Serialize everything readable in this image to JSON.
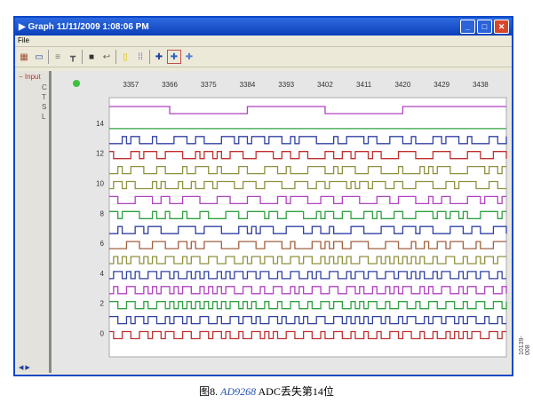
{
  "window": {
    "title": "Graph 11/11/2009 1:08:06 PM",
    "menu": [
      "File"
    ],
    "controls": [
      "_",
      "□",
      "✕"
    ]
  },
  "toolbar": {
    "tools": [
      "open-icon",
      "window-icon",
      "list-icon",
      "tree-icon",
      "save-icon",
      "undo-icon",
      "yellow-marker-icon",
      "blue-marker-icon",
      "crosshair-icon",
      "zoom-crosshair-icon",
      "pan-crosshair-icon"
    ]
  },
  "tree": {
    "root": "Input",
    "children": [
      "C",
      "T",
      "S",
      "L"
    ]
  },
  "chart_data": {
    "type": "line",
    "title": "",
    "xlabel": "",
    "ylabel": "",
    "x_ticks": [
      "3357",
      "3366",
      "3375",
      "3384",
      "3393",
      "3402",
      "3411",
      "3420",
      "3429",
      "3438"
    ],
    "y_ticks": [
      "14",
      "12",
      "10",
      "8",
      "6",
      "4",
      "2",
      "0"
    ],
    "bits": 16,
    "stuck_bit": 14,
    "bit15_transitions": [
      3366,
      3384,
      3402,
      3420
    ],
    "colors": [
      "#c03030",
      "#3040a0",
      "#30a040",
      "#b040c0",
      "#3040a0",
      "#909040",
      "#a06040",
      "#3040a0",
      "#30a040",
      "#b040c0",
      "#909040",
      "#909040",
      "#c03030",
      "#3040a0",
      "#30a040",
      "#b040c0"
    ]
  },
  "caption": {
    "prefix": "图8. ",
    "part": "AD9268",
    "suffix": " ADC丢失第14位"
  },
  "side_label": "10139-008"
}
